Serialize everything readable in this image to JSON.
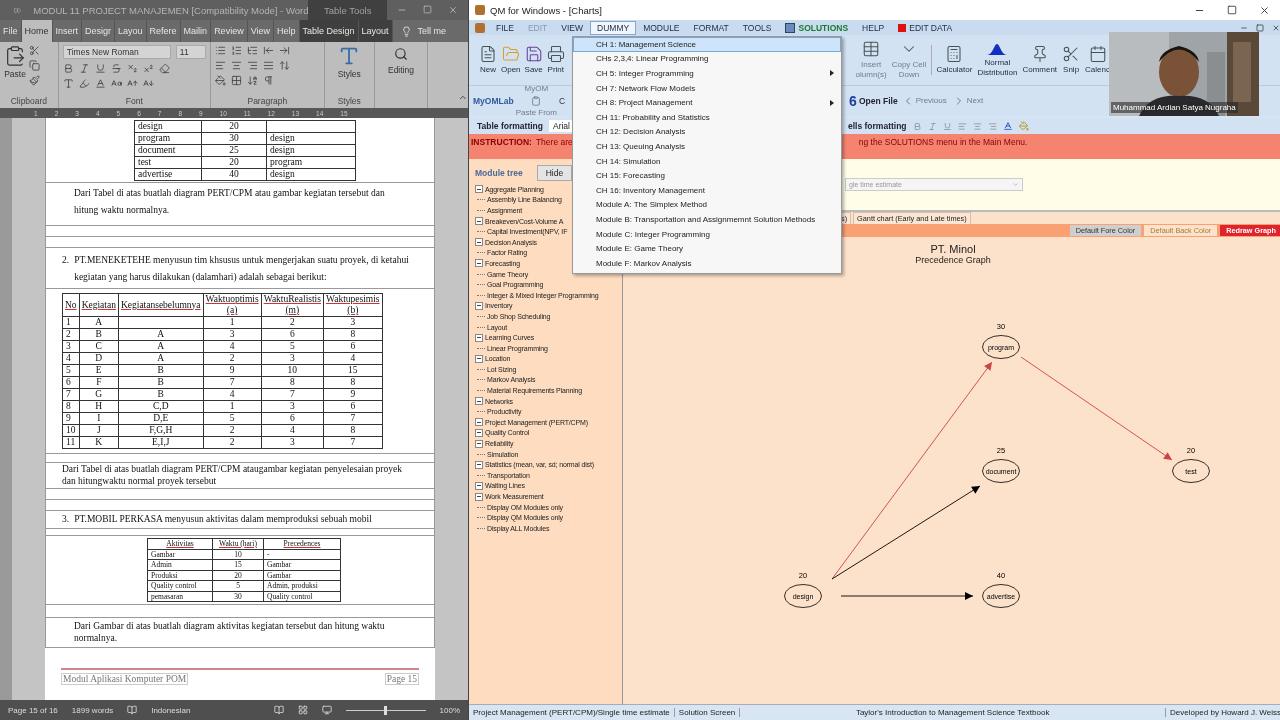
{
  "word": {
    "title": "MODUL 11 PROJECT MANAJEMEN [Compatibility Mode]  -  Word",
    "context_title": "Table Tools",
    "tabs": [
      {
        "label": "File",
        "selected": false,
        "kind": "normal"
      },
      {
        "label": "Home",
        "selected": true,
        "kind": "normal"
      },
      {
        "label": "Insert",
        "selected": false,
        "kind": "normal"
      },
      {
        "label": "Desigr",
        "selected": false,
        "kind": "normal"
      },
      {
        "label": "Layou",
        "selected": false,
        "kind": "normal"
      },
      {
        "label": "Refere",
        "selected": false,
        "kind": "normal"
      },
      {
        "label": "Mailin",
        "selected": false,
        "kind": "normal"
      },
      {
        "label": "Review",
        "selected": false,
        "kind": "normal"
      },
      {
        "label": "View",
        "selected": false,
        "kind": "normal"
      },
      {
        "label": "Help",
        "selected": false,
        "kind": "normal"
      },
      {
        "label": "Table Design",
        "selected": false,
        "kind": "contextual"
      },
      {
        "label": "Layout",
        "selected": false,
        "kind": "contextual"
      }
    ],
    "tell_me": "Tell me",
    "ribbon": {
      "paste": "Paste",
      "font_name": "Times New Roman",
      "font_size": "11",
      "styles": "Styles",
      "editing": "Editing",
      "groups": [
        "Clipboard",
        "Font",
        "Paragraph",
        "Styles"
      ]
    },
    "ruler": [
      "1",
      "2",
      "3",
      "4",
      "5",
      "6",
      "7",
      "8",
      "9",
      "10",
      "11",
      "12",
      "13",
      "14",
      "15"
    ],
    "document": {
      "table_1": [
        {
          "activity": "design",
          "time": "20"
        },
        {
          "activity": "program",
          "time": "30",
          "precedence": "design"
        },
        {
          "activity": "document",
          "time": "25",
          "precedence": "design"
        },
        {
          "activity": "test",
          "time": "20",
          "precedence": "program"
        },
        {
          "activity": "advertise",
          "time": "40",
          "precedence": "design"
        }
      ],
      "paragraph_1": "Dari Tabel di atas buatlah diagram PERT/CPM atau gambar kegiatan  tersebut  dan hitung waktu normalnya.",
      "question_2": {
        "number": "2.",
        "text": "PT.MENEKETEHE menyusun tim khsusus untuk  mengerjakan suatu proyek, di ketahui kegiatan yang harus dilakukan (dalamhari) adalah sebagai berikut:"
      },
      "table_2": {
        "columns": [
          {
            "label": "No"
          },
          {
            "label": "Kegiatan"
          },
          {
            "label": "Kegiatansebelumnya"
          },
          {
            "label": "Waktuoptimis",
            "sub": "(a)"
          },
          {
            "label": "WaktuRealistis",
            "sub": "(m)"
          },
          {
            "label": "Waktupesimis",
            "sub": "(b)"
          }
        ],
        "rows": [
          {
            "no": "1",
            "activity": "A",
            "a": "1",
            "m": "2",
            "b": "3"
          },
          {
            "no": "2",
            "activity": "B",
            "before": "A",
            "a": "3",
            "m": "6",
            "b": "8"
          },
          {
            "no": "3",
            "activity": "C",
            "before": "A",
            "a": "4",
            "m": "5",
            "b": "6"
          },
          {
            "no": "4",
            "activity": "D",
            "before": "A",
            "a": "2",
            "m": "3",
            "b": "4"
          },
          {
            "no": "5",
            "activity": "E",
            "before": "B",
            "a": "9",
            "m": "10",
            "b": "15"
          },
          {
            "no": "6",
            "activity": "F",
            "before": "B",
            "a": "7",
            "m": "8",
            "b": "8"
          },
          {
            "no": "7",
            "activity": "G",
            "before": "B",
            "a": "4",
            "m": "7",
            "b": "9"
          },
          {
            "no": "8",
            "activity": "H",
            "before": "C,D",
            "a": "1",
            "m": "3",
            "b": "6"
          },
          {
            "no": "9",
            "activity": "I",
            "before": "D,E",
            "a": "5",
            "m": "6",
            "b": "7"
          },
          {
            "no": "10",
            "activity": "J",
            "before": "F,G,H",
            "a": "2",
            "m": "4",
            "b": "8"
          },
          {
            "no": "11",
            "activity": "K",
            "before": "E,I,J",
            "a": "2",
            "m": "3",
            "b": "7"
          }
        ]
      },
      "paragraph_2": "Dari Tabel di atas buatlah diagram PERT/CPM ataugambar kegiatan penyelesaian proyek dan hitungwaktu normal proyek tersebut",
      "question_3": {
        "number": "3.",
        "text": "PT.MOBIL PERKASA menyusun aktivitas dalam memproduksi sebuah mobil"
      },
      "table_3": {
        "columns": [
          "Aktivitas",
          "Waktu (hari)",
          "Precedences"
        ],
        "rows": [
          {
            "activity": "Gambar",
            "time": "10",
            "precedence": "-"
          },
          {
            "activity": "Admin",
            "time": "15",
            "precedence": "Gambar"
          },
          {
            "activity": "Produksi",
            "time": "20",
            "precedence": "Gambar"
          },
          {
            "activity": "Quality control",
            "time": "5",
            "precedence": "Admin, produksi"
          },
          {
            "activity": "pemasaran",
            "time": "30",
            "precedence": "Quality control"
          }
        ]
      },
      "paragraph_3": "Dari Gambar di atas buatlah diagram aktivitas kegiatan tersebut dan hitung waktu normalnya.",
      "footer": {
        "left": "Modul Aplikasi Komputer POM",
        "right": "Page 15"
      }
    },
    "status_bar": {
      "page": "Page 15 of 16",
      "words": "1899 words",
      "language": "Indonesian",
      "zoom_slider": {
        "level": 0.5
      },
      "zoom": "100%"
    }
  },
  "qm": {
    "title": "QM for Windows - [Charts]",
    "menu": [
      {
        "label": "FILE",
        "kind": "plain",
        "disabled": false,
        "selected": false
      },
      {
        "label": "EDIT",
        "kind": "plain",
        "disabled": true,
        "selected": false
      },
      {
        "label": "VIEW",
        "kind": "plain",
        "disabled": false,
        "selected": false
      },
      {
        "label": "DUMMY",
        "kind": "plain",
        "disabled": false,
        "selected": true
      },
      {
        "label": "MODULE",
        "kind": "plain",
        "disabled": false,
        "selected": false
      },
      {
        "label": "FORMAT",
        "kind": "plain",
        "disabled": false,
        "selected": false
      },
      {
        "label": "TOOLS",
        "kind": "plain",
        "disabled": false,
        "selected": false
      },
      {
        "label": "SOLUTIONS",
        "kind": "solutions",
        "disabled": false,
        "selected": false
      },
      {
        "label": "HELP",
        "kind": "plain",
        "disabled": false,
        "selected": false
      },
      {
        "label": "EDIT DATA",
        "kind": "edit_data",
        "disabled": false,
        "selected": false
      }
    ],
    "dropdown": [
      {
        "label": "CH 1: Management Science",
        "selected": true,
        "submenu": false
      },
      {
        "label": "CHs 2,3,4: Linear Programming",
        "selected": false,
        "submenu": false
      },
      {
        "label": "CH 5: Integer Programming",
        "selected": false,
        "submenu": true
      },
      {
        "label": "CH 7: Network Flow Models",
        "selected": false,
        "submenu": false
      },
      {
        "label": "CH 8: Project Management",
        "selected": false,
        "submenu": true
      },
      {
        "label": "CH 11: Probability and Statistics",
        "selected": false,
        "submenu": false
      },
      {
        "label": "CH 12: Decision Analysis",
        "selected": false,
        "submenu": false
      },
      {
        "label": "CH 13: Queuing Analysis",
        "selected": false,
        "submenu": false
      },
      {
        "label": "CH 14: Simulation",
        "selected": false,
        "submenu": false
      },
      {
        "label": "CH 15: Forecasting",
        "selected": false,
        "submenu": false
      },
      {
        "label": "CH 16: Inventory Management",
        "selected": false,
        "submenu": false
      },
      {
        "label": "Module A: The Simplex Method",
        "selected": false,
        "submenu": false
      },
      {
        "label": "Module B: Transportation and Assignmemnt Solution Methods",
        "selected": false,
        "submenu": false
      },
      {
        "label": "Module C: Integer Programming",
        "selected": false,
        "submenu": false
      },
      {
        "label": "Module E: Game Theory",
        "selected": false,
        "submenu": false
      },
      {
        "label": "Module F: Markov Analysis",
        "selected": false,
        "submenu": false
      }
    ],
    "toolbar_left": [
      {
        "label": "New",
        "kind": "new"
      },
      {
        "label": "Open",
        "kind": "open"
      },
      {
        "label": "Save",
        "kind": "save"
      },
      {
        "label": "Print",
        "kind": "print"
      }
    ],
    "toolbar_right": [
      {
        "lines": [
          "Insert",
          "olumn(s)"
        ],
        "kind": "insert",
        "disabled": true
      },
      {
        "lines": [
          "Copy Cell",
          "Down"
        ],
        "kind": "copy",
        "disabled": true
      },
      {
        "lines": [
          "Calculator"
        ],
        "kind": "calculator",
        "disabled": false
      },
      {
        "lines": [
          "Normal",
          "Distribution"
        ],
        "kind": "normal",
        "disabled": false
      },
      {
        "lines": [
          "Comment"
        ],
        "kind": "comment",
        "disabled": false
      },
      {
        "lines": [
          "Snip"
        ],
        "kind": "snip",
        "disabled": false
      },
      {
        "lines": [
          "Calenc"
        ],
        "kind": "calendar",
        "disabled": false
      }
    ],
    "toolbar2": {
      "myomlab": "MyOMLab",
      "myom": "MyOM",
      "paste_from": "Paste From",
      "fragment": "C",
      "step": "6",
      "open_file": "Open File",
      "previous": "Previous",
      "next": "Next"
    },
    "format_bar": {
      "table_formatting": "Table formatting",
      "font": "Arial",
      "cells_formatting": "ells formatting"
    },
    "instruction": {
      "label": "INSTRUCTION:",
      "left": "There are",
      "right": "ng the SOLUTIONS menu in the Main Menu."
    },
    "module_tree": {
      "title": "Module tree",
      "hide": "Hide",
      "items": [
        {
          "label": "Aggregate Planning",
          "kind": "group"
        },
        {
          "label": "Assembly Line Balancing",
          "kind": "leaf"
        },
        {
          "label": "Assignment",
          "kind": "leaf"
        },
        {
          "label": "Breakeven/Cost-Volume A",
          "kind": "group"
        },
        {
          "label": "Capital Investment(NPV, IF",
          "kind": "leaf"
        },
        {
          "label": "Decision Analysis",
          "kind": "group"
        },
        {
          "label": "Factor Rating",
          "kind": "leaf"
        },
        {
          "label": "Forecasting",
          "kind": "group"
        },
        {
          "label": "Game Theory",
          "kind": "leaf"
        },
        {
          "label": "Goal Programming",
          "kind": "leaf"
        },
        {
          "label": "Integer & Mixed Integer Programming",
          "kind": "leaf"
        },
        {
          "label": "Inventory",
          "kind": "group"
        },
        {
          "label": "Job Shop Scheduling",
          "kind": "leaf"
        },
        {
          "label": "Layout",
          "kind": "leaf"
        },
        {
          "label": "Learning Curves",
          "kind": "group"
        },
        {
          "label": "Linear Programming",
          "kind": "leaf"
        },
        {
          "label": "Location",
          "kind": "group"
        },
        {
          "label": "Lot Sizing",
          "kind": "leaf"
        },
        {
          "label": "Markov Analysis",
          "kind": "leaf"
        },
        {
          "label": "Material Requirements Planning",
          "kind": "leaf"
        },
        {
          "label": "Networks",
          "kind": "group"
        },
        {
          "label": "Productivity",
          "kind": "leaf"
        },
        {
          "label": "Project Management (PERT/CPM)",
          "kind": "group"
        },
        {
          "label": "Quality Control",
          "kind": "group"
        },
        {
          "label": "Reliability",
          "kind": "group"
        },
        {
          "label": "Simulation",
          "kind": "leaf"
        },
        {
          "label": "Statistics (mean, var, sd; normal dist)",
          "kind": "group"
        },
        {
          "label": "Transportation",
          "kind": "leaf"
        },
        {
          "label": "Waiting Lines",
          "kind": "group"
        },
        {
          "label": "Work Measurement",
          "kind": "group"
        },
        {
          "label": "Display OM Modules only",
          "kind": "leaf"
        },
        {
          "label": "Display QM Modules only",
          "kind": "leaf"
        },
        {
          "label": "Display ALL Modules",
          "kind": "leaf"
        }
      ]
    },
    "method_select": "gle time estimate",
    "tabs": [
      {
        "label": "s)",
        "selected": false
      },
      {
        "label": "Gantt chart (Early and Late times)",
        "selected": false
      }
    ],
    "graph_buttons": [
      {
        "label": "Default Fore Color",
        "kind": "fore"
      },
      {
        "label": "Default Back Color",
        "kind": "back"
      },
      {
        "label": "Redraw Graph",
        "kind": "redraw"
      }
    ],
    "graph": {
      "title": "PT. Minol",
      "subtitle": "Precedence Graph",
      "nodes": [
        {
          "label": "design",
          "time": "20"
        },
        {
          "label": "program",
          "time": "30"
        },
        {
          "label": "document",
          "time": "25"
        },
        {
          "label": "test",
          "time": "20"
        },
        {
          "label": "advertise",
          "time": "40"
        }
      ],
      "edges": [
        {
          "critical": true
        },
        {
          "critical": false
        },
        {
          "critical": false
        },
        {
          "critical": true
        }
      ]
    },
    "webcam": {
      "name": "Muhammad Ardian Satya Nugraha"
    },
    "status_bar": [
      "Project Management (PERT/CPM)/Single time estimate",
      "Solution Screen",
      "Taylor's Introduction to Management Science Textbook",
      "Developed by Howard J. Weiss"
    ]
  }
}
